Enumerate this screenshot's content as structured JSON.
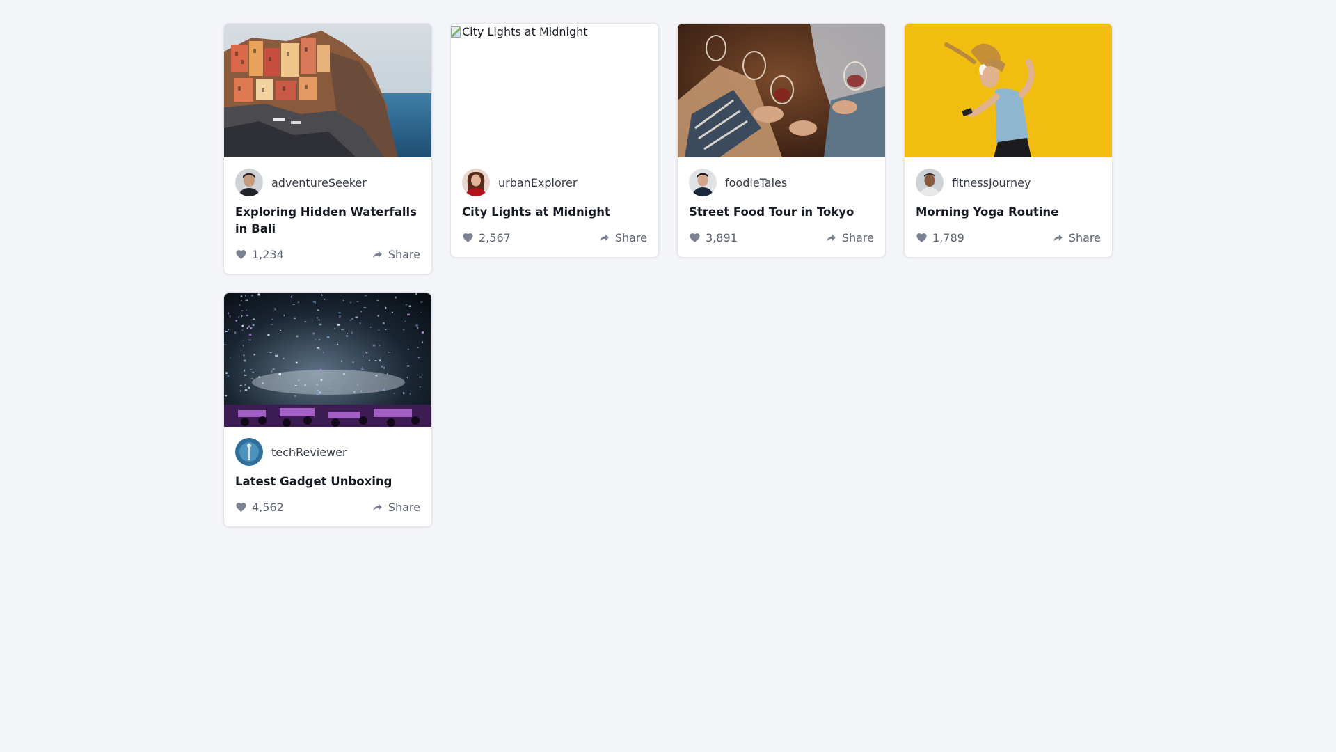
{
  "icons": {
    "like": "heart-icon",
    "share": "share-icon"
  },
  "colors": {
    "background": "#f4f5f8",
    "card": "#ffffff",
    "icon": "#7a8190",
    "text_muted": "#5b6270"
  },
  "posts": [
    {
      "username": "adventureSeeker",
      "title": "Exploring Hidden Waterfalls in Bali",
      "likes": "1,234",
      "share_label": "Share",
      "image_alt": "Exploring Hidden Waterfalls in Bali"
    },
    {
      "username": "urbanExplorer",
      "title": "City Lights at Midnight",
      "likes": "2,567",
      "share_label": "Share",
      "image_alt": "City Lights at Midnight"
    },
    {
      "username": "foodieTales",
      "title": "Street Food Tour in Tokyo",
      "likes": "3,891",
      "share_label": "Share",
      "image_alt": "Street Food Tour in Tokyo"
    },
    {
      "username": "fitnessJourney",
      "title": "Morning Yoga Routine",
      "likes": "1,789",
      "share_label": "Share",
      "image_alt": "Morning Yoga Routine"
    },
    {
      "username": "techReviewer",
      "title": "Latest Gadget Unboxing",
      "likes": "4,562",
      "share_label": "Share",
      "image_alt": "Latest Gadget Unboxing"
    }
  ]
}
